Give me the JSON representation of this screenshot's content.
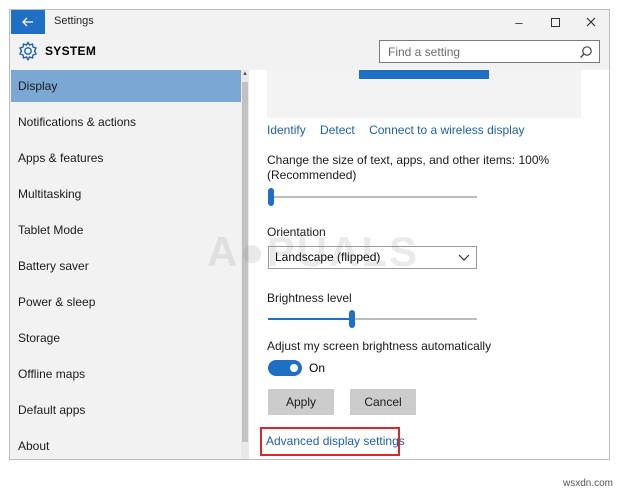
{
  "window": {
    "title": "Settings",
    "controls": [
      "minimize",
      "maximize",
      "close"
    ]
  },
  "header": {
    "section": "SYSTEM",
    "search_placeholder": "Find a setting"
  },
  "sidebar": {
    "items": [
      {
        "label": "Display",
        "active": true
      },
      {
        "label": "Notifications & actions"
      },
      {
        "label": "Apps & features"
      },
      {
        "label": "Multitasking"
      },
      {
        "label": "Tablet Mode"
      },
      {
        "label": "Battery saver"
      },
      {
        "label": "Power & sleep"
      },
      {
        "label": "Storage"
      },
      {
        "label": "Offline maps"
      },
      {
        "label": "Default apps"
      },
      {
        "label": "About"
      }
    ]
  },
  "main": {
    "links": [
      "Identify",
      "Detect",
      "Connect to a wireless display"
    ],
    "size_label": "Change the size of text, apps, and other items: 100%",
    "size_label_2": "(Recommended)",
    "size_slider_value": 0,
    "orientation_label": "Orientation",
    "orientation_value": "Landscape (flipped)",
    "brightness_label": "Brightness level",
    "brightness_value": 0.4,
    "auto_brightness_label": "Adjust my screen brightness automatically",
    "toggle_state": "On",
    "apply_label": "Apply",
    "cancel_label": "Cancel",
    "advanced_link": "Advanced display settings"
  },
  "colors": {
    "accent": "#1f6fc5",
    "highlight_box": "#d9272e",
    "active_nav": "#7aa7d4"
  },
  "watermark": {
    "text": "APPUALS",
    "site": "wsxdn.com"
  }
}
